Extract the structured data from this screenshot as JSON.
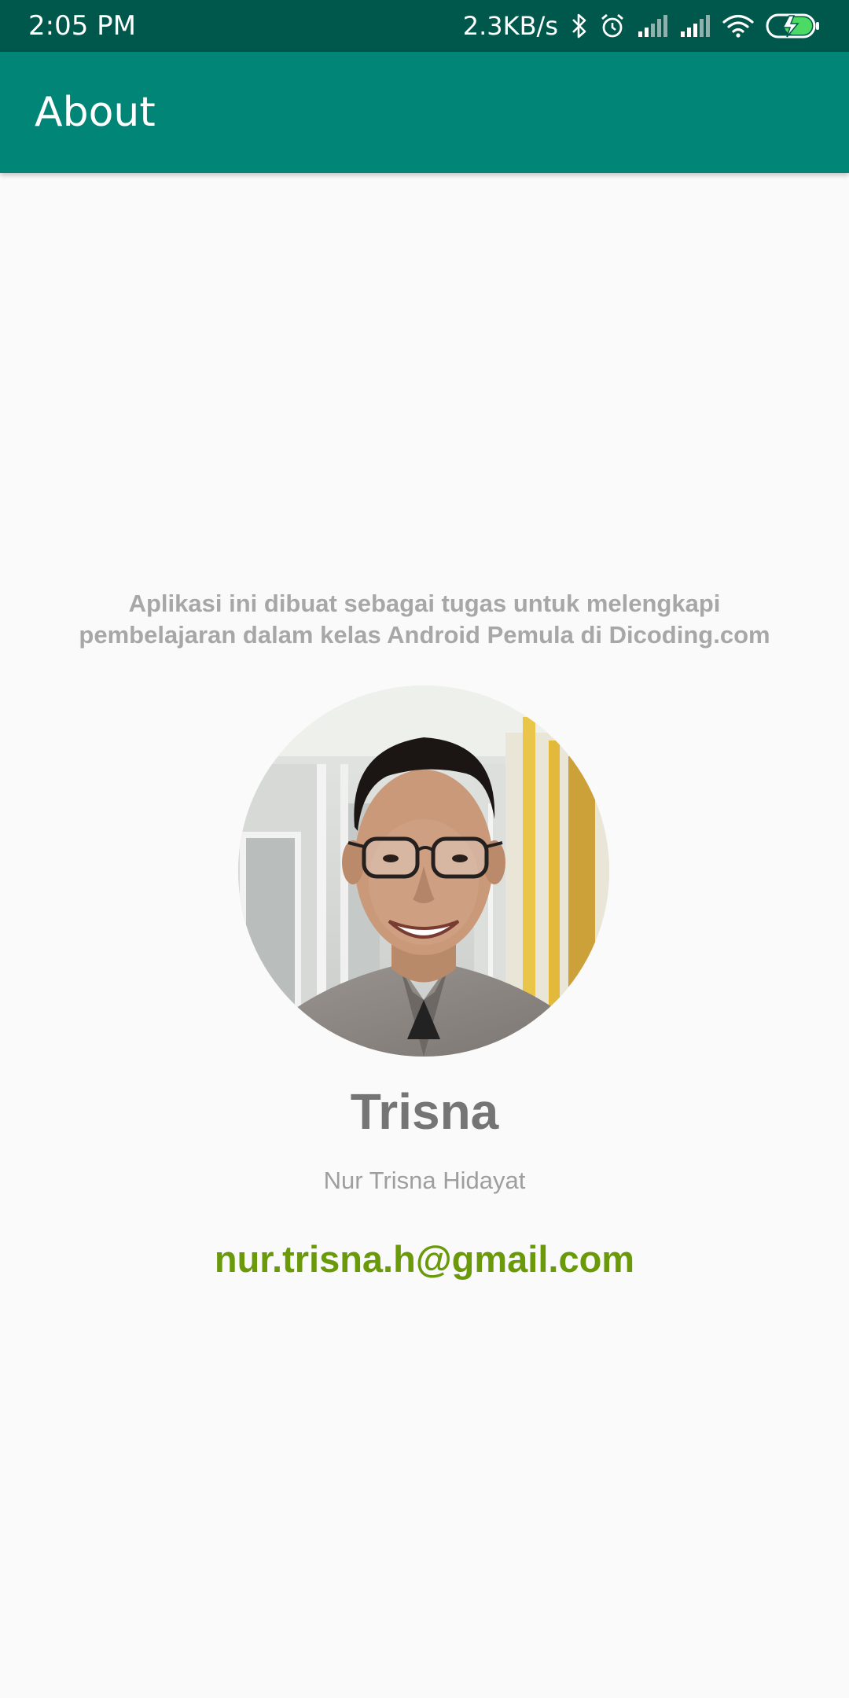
{
  "status_bar": {
    "time": "2:05 PM",
    "network_speed": "2.3KB/s",
    "icons": [
      "bluetooth-icon",
      "alarm-icon",
      "signal-icon",
      "signal-icon",
      "wifi-icon",
      "battery-charging-icon"
    ],
    "battery_accent": "#4cd964"
  },
  "app_bar": {
    "title": "About",
    "color": "#008577",
    "status_color": "#00574b"
  },
  "about": {
    "description": "Aplikasi ini dibuat sebagai tugas untuk melengkapi pembelajaran dalam kelas Android Pemula di Dicoding.com",
    "nickname": "Trisna",
    "full_name": "Nur Trisna Hidayat",
    "email": "nur.trisna.h@gmail.com",
    "email_color": "#6a9a0a"
  }
}
